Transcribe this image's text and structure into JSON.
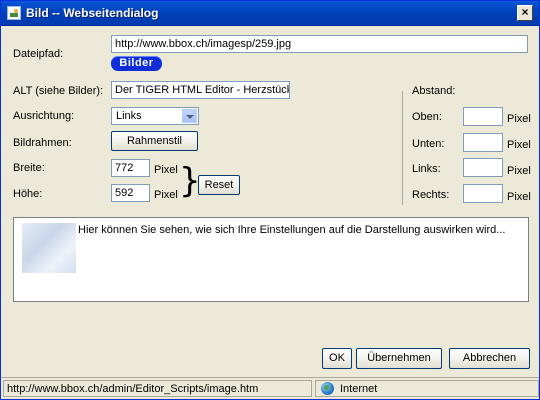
{
  "window": {
    "title": "Bild -- Webseitendialog",
    "close_glyph": "×"
  },
  "form": {
    "dateipfad_label": "Dateipfad:",
    "dateipfad_value": "http://www.bbox.ch/imagesp/259.jpg",
    "bilder_button": "Bilder",
    "alt_label": "ALT (siehe Bilder):",
    "alt_value": "Der TIGER HTML Editor - Herzstück d",
    "ausrichtung_label": "Ausrichtung:",
    "ausrichtung_value": "Links",
    "bildrahmen_label": "Bildrahmen:",
    "rahmenstil_button": "Rahmenstil",
    "breite_label": "Breite:",
    "breite_value": "772",
    "hoehe_label": "Höhe:",
    "hoehe_value": "592",
    "pixel_unit": "Pixel",
    "reset_button": "Reset"
  },
  "abstand": {
    "title": "Abstand:",
    "oben_label": "Oben:",
    "unten_label": "Unten:",
    "links_label": "Links:",
    "rechts_label": "Rechts:",
    "oben_value": "",
    "unten_value": "",
    "links_value": "",
    "rechts_value": "",
    "pixel_unit": "Pixel"
  },
  "preview": {
    "text": "Hier können Sie sehen, wie sich Ihre Einstellungen auf die Darstellung auswirken wird..."
  },
  "buttons": {
    "ok": "OK",
    "apply": "Übernehmen",
    "cancel": "Abbrechen"
  },
  "statusbar": {
    "url": "http://www.bbox.ch/admin/Editor_Scripts/image.htm",
    "zone": "Internet"
  },
  "colors": {
    "titlebar": "#0040b8",
    "bilder_button": "#0f2ed8",
    "dialog_bg": "#ece9d8"
  }
}
